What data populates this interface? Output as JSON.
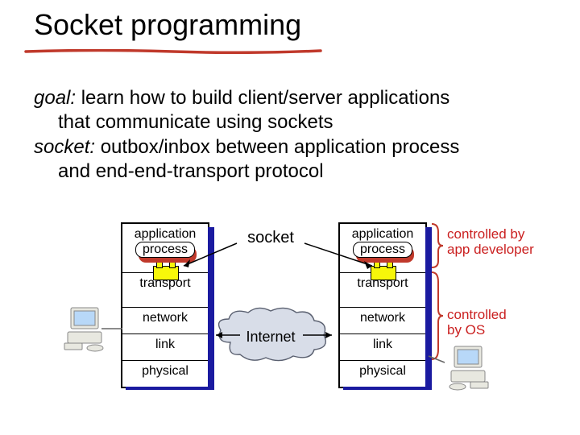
{
  "title": "Socket programming",
  "intro": {
    "goal_label": "goal:",
    "goal_rest": " learn how to build client/server applications",
    "goal_line2": "that communicate using sockets",
    "socket_label": "socket:",
    "socket_rest": " outbox/inbox between application process",
    "socket_line2": "and end-end-transport protocol"
  },
  "stack": {
    "application": "application",
    "process": "process",
    "transport": "transport",
    "network": "network",
    "link": "link",
    "physical": "physical"
  },
  "labels": {
    "socket": "socket",
    "internet": "Internet",
    "ctrl_dev_1": "controlled by",
    "ctrl_dev_2": "app developer",
    "ctrl_os_1": "controlled",
    "ctrl_os_2": "by OS"
  }
}
